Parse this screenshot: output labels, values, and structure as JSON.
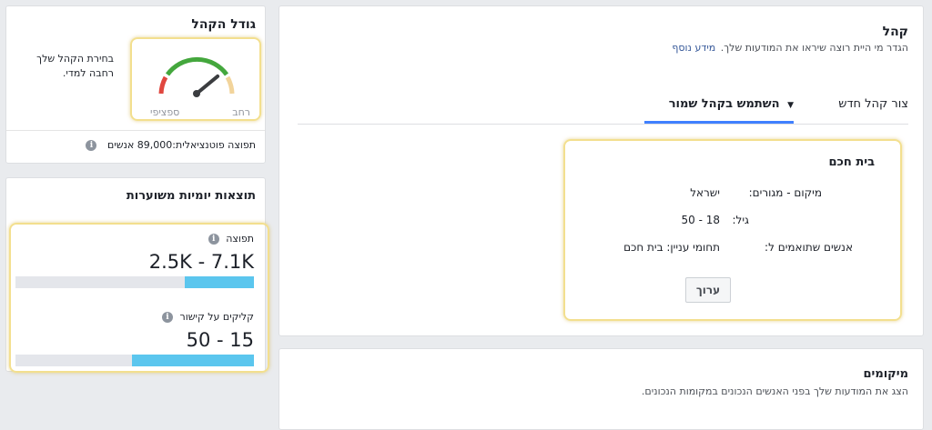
{
  "audience_size": {
    "title": "גודל הקהל",
    "description_line1": "בחירת הקהל שלך",
    "description_line2": "רחבה למדי.",
    "gauge_left_label": "ספציפי",
    "gauge_right_label": "רחב",
    "gauge_level": 0.78,
    "potential_reach": "תפוצה פוטנציאלית:89,000 אנשים"
  },
  "daily_results": {
    "title": "תוצאות יומיות משוערות",
    "reach": {
      "label": "תפוצה",
      "value": "2.5K - 7.1K",
      "fill_fraction": 0.29
    },
    "clicks": {
      "label": "קליקים על קישור",
      "value": "50 - 15",
      "fill_fraction": 0.51
    }
  },
  "audience": {
    "title": "קהל",
    "subtitle": "הגדר מי היית רוצה שיראו את המודעות שלך.",
    "more_info_link": "מידע נוסף",
    "tabs": [
      {
        "label": "צור קהל חדש",
        "active": false
      },
      {
        "label": "השתמש בקהל שמור",
        "active": true
      }
    ],
    "saved": {
      "name": "בית חכם",
      "rows": [
        {
          "key": "מיקום - מגורים:",
          "value": "ישראל"
        },
        {
          "key": "גיל:",
          "value": "18 - 50"
        },
        {
          "key": "אנשים שתואמים ל:",
          "value": "תחומי עניין: בית חכם"
        }
      ],
      "edit_button": "ערוך"
    }
  },
  "placements": {
    "title": "מיקומים",
    "subtitle": "הצג את המודעות שלך בפני האנשים הנכונים במקומות הנכונים."
  },
  "colors": {
    "accent": "#4080ff",
    "link": "#365899",
    "bar_fill": "#5bc6ee",
    "highlight": "#f3df8e"
  }
}
